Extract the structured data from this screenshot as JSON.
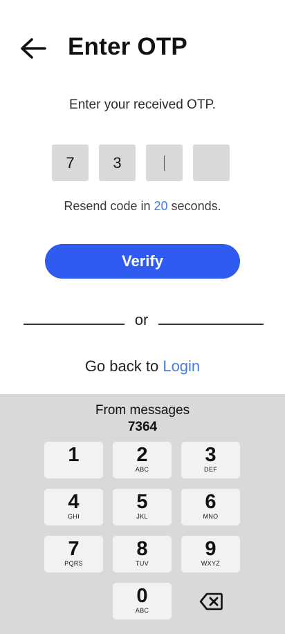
{
  "header": {
    "back_icon": "arrow-left-icon",
    "title": "Enter OTP"
  },
  "subtitle": "Enter your received OTP.",
  "otp": {
    "digits": [
      "7",
      "3",
      "",
      ""
    ],
    "active_index": 2
  },
  "resend": {
    "prefix": "Resend code in",
    "count": "20",
    "suffix": "seconds."
  },
  "verify_label": "Verify",
  "divider_text": "or",
  "goback": {
    "text": "Go back to",
    "link": "Login"
  },
  "keyboard": {
    "suggestion_label": "From messages",
    "suggestion_code": "7364",
    "keys": [
      {
        "digit": "1",
        "letters": ""
      },
      {
        "digit": "2",
        "letters": "ABC"
      },
      {
        "digit": "3",
        "letters": "DEF"
      },
      {
        "digit": "4",
        "letters": "GHI"
      },
      {
        "digit": "5",
        "letters": "JKL"
      },
      {
        "digit": "6",
        "letters": "MNO"
      },
      {
        "digit": "7",
        "letters": "PQRS"
      },
      {
        "digit": "8",
        "letters": "TUV"
      },
      {
        "digit": "9",
        "letters": "WXYZ"
      },
      {
        "digit": "0",
        "letters": "ABC"
      }
    ],
    "backspace_icon": "backspace-icon"
  },
  "colors": {
    "primary": "#2f5bf0",
    "link": "#4a7de0",
    "otp_box": "#d9d9d9",
    "keyboard_bg": "#d9d9d9",
    "key_bg": "#f2f2f2"
  }
}
